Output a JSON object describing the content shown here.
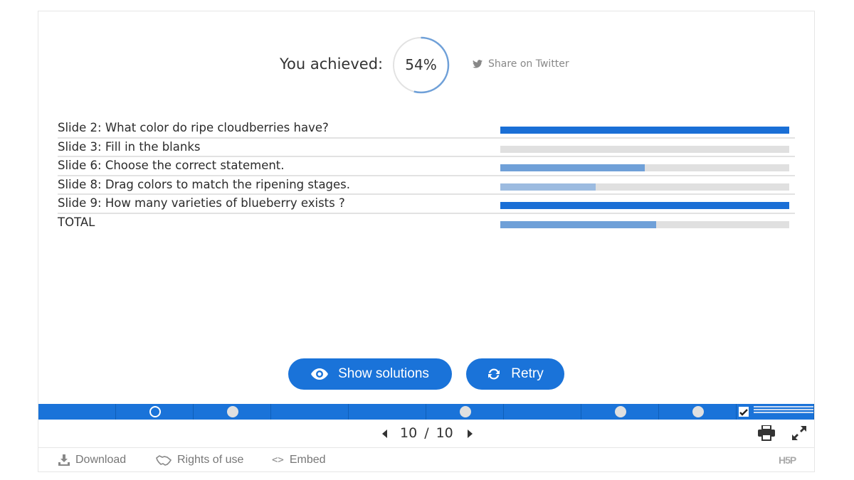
{
  "score": {
    "label": "You achieved:",
    "percent_text": "54%",
    "percent": 54,
    "share_label": "Share on Twitter"
  },
  "results": [
    {
      "title": "Slide 2: What color do ripe cloudberries have?",
      "score_fraction": 1.0,
      "color": "#1a6fd6"
    },
    {
      "title": "Slide 3: Fill in the blanks",
      "score_fraction": 0.0,
      "color": "#1a6fd6"
    },
    {
      "title": "Slide 6: Choose the correct statement.",
      "score_fraction": 0.5,
      "color": "#6fa0d8"
    },
    {
      "title": "Slide 8: Drag colors to match the ripening stages.",
      "score_fraction": 0.33,
      "color": "#9cbbe0"
    },
    {
      "title": "Slide 9: How many varieties of blueberry exists ?",
      "score_fraction": 1.0,
      "color": "#1a6fd6"
    }
  ],
  "total": {
    "title": "TOTAL",
    "score_fraction": 0.54,
    "color": "#6fa0d8"
  },
  "buttons": {
    "show_solutions": "Show solutions",
    "retry": "Retry"
  },
  "progress": {
    "slides": 10,
    "current": 10,
    "dots": [
      "none",
      "hollow",
      "filled",
      "none",
      "none",
      "filled",
      "none",
      "filled",
      "filled",
      "check"
    ]
  },
  "nav": {
    "current": "10",
    "separator": "/",
    "total": "10"
  },
  "actions": {
    "download": "Download",
    "rights": "Rights of use",
    "embed": "Embed",
    "logo": "H5P"
  },
  "colors": {
    "accent": "#1a73d9",
    "track": "#e0e0e0"
  }
}
